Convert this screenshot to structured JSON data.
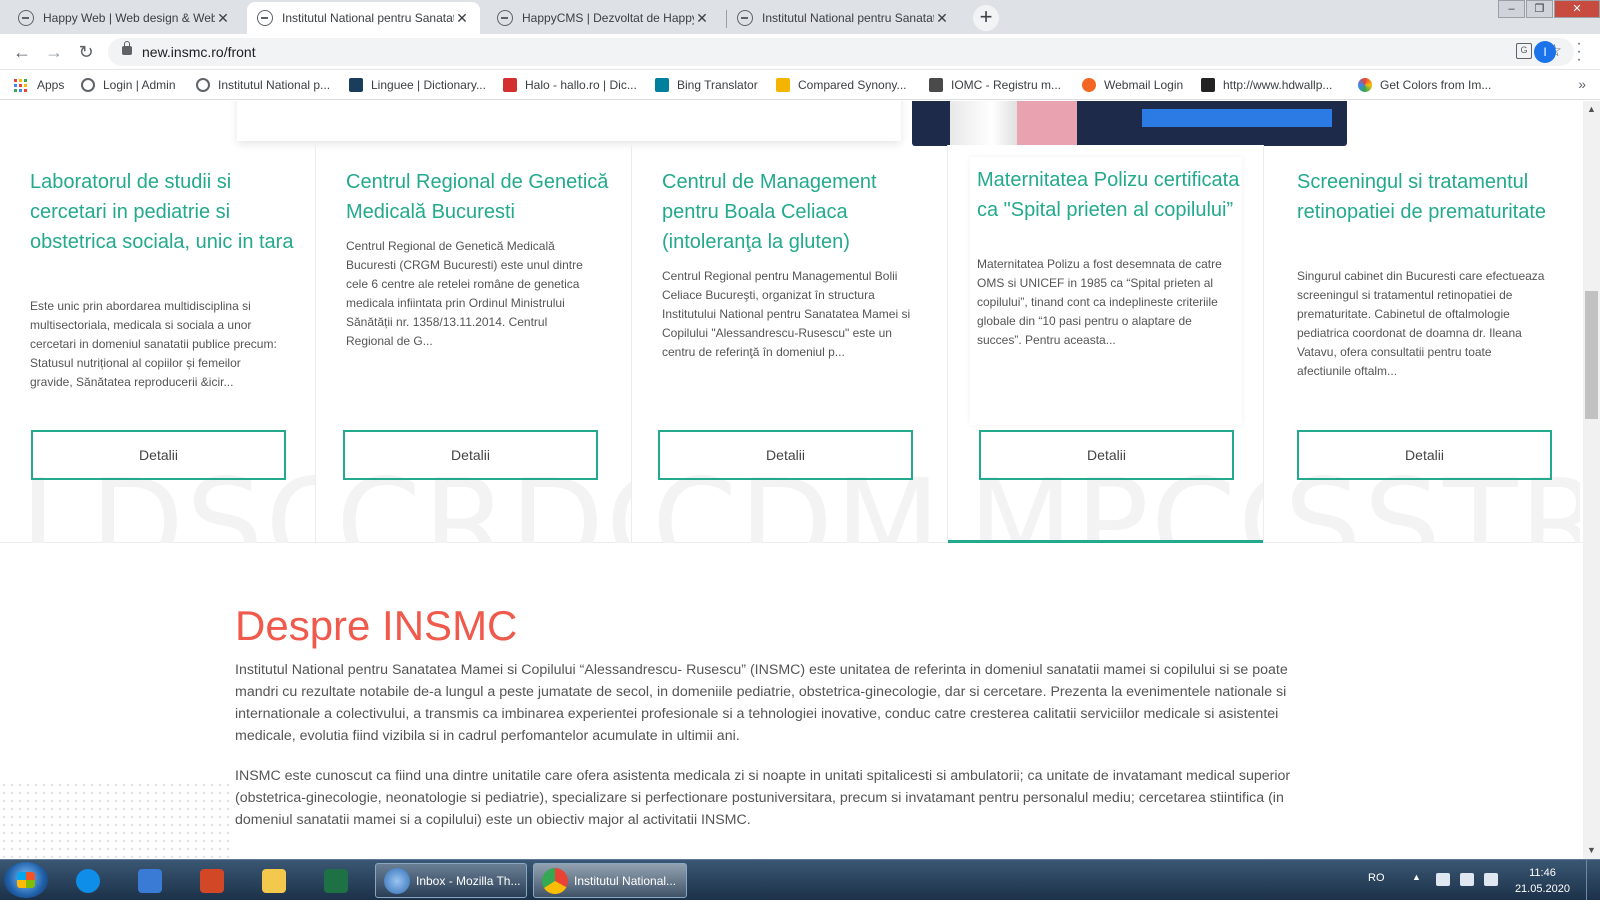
{
  "browser": {
    "tabs": [
      {
        "title": "Happy Web | Web design & Web",
        "active": false
      },
      {
        "title": "Institutul National pentru Sanatat",
        "active": true
      },
      {
        "title": "HappyCMS | Dezvoltat de Happy",
        "active": false
      },
      {
        "title": "Institutul National pentru Sanatat",
        "active": false
      }
    ],
    "tab_close": "✕",
    "new_tab": "+",
    "url": "new.insmc.ro/front",
    "profile_initial": "I",
    "bookmarks": [
      {
        "label": "Apps"
      },
      {
        "label": "Login | Admin"
      },
      {
        "label": "Institutul National p..."
      },
      {
        "label": "Linguee | Dictionary..."
      },
      {
        "label": "Halo - hallo.ro | Dic..."
      },
      {
        "label": "Bing Translator"
      },
      {
        "label": "Compared Synony..."
      },
      {
        "label": "IOMC - Registru m..."
      },
      {
        "label": "Webmail Login"
      },
      {
        "label": "http://www.hdwallp..."
      },
      {
        "label": "Get Colors from Im..."
      }
    ],
    "bookmarks_more": "»"
  },
  "page": {
    "services": [
      {
        "title": "Laboratorul de studii si cercetari in pediatrie si obstetrica sociala, unic in tara",
        "description": "Este unic prin  abordarea multidisciplina si multisectoriala, medicala si sociala a unor cercetari in  domeniul sanatatii publice precum: Statusul nutrițional al copiilor și femeilor gravide, Sănătatea reproducerii &icir...",
        "button": "Detalii",
        "watermark": "LDSC"
      },
      {
        "title": "Centrul Regional de Genetică Medicală Bucuresti",
        "description": "Centrul Regional de Genetică Medicală Bucuresti (CRGM Bucuresti) este unul dintre cele 6 centre ale retelei române de genetica medicala infiintata prin Ordinul Ministrului Sănătății nr. 1358/13.11.2014. Centrul Regional de G...",
        "button": "Detalii",
        "watermark": "CRDG"
      },
      {
        "title": "Centrul de Management pentru Boala Celiaca (intoleranţa la gluten)",
        "description": "Centrul Regional pentru Managementul Bolii Celiace Bucureşti, organizat în structura Institutului National pentru Sanatatea Mamei si Copilului \"Alessandrescu-Rusescu\" este un centru de referinţă în domeniul p...",
        "button": "Detalii",
        "watermark": "CDMP"
      },
      {
        "title": "Maternitatea Polizu certificata ca \"Spital prieten al copilului”",
        "description": "Maternitatea Polizu a fost desemnata de catre OMS si UNICEF in 1985 ca “Spital prieten al copilului”, tinand cont ca indeplineste criteriile globale din “10 pasi pentru o alaptare de succes”. Pentru aceasta...",
        "button": "Detalii",
        "watermark": "MPCC"
      },
      {
        "title": "Screeningul si tratamentul retinopatiei de prematuritate",
        "description": "Singurul cabinet din Bucuresti care efectueaza screeningul si tratamentul retinopatiei de prematuritate. Cabinetul de oftalmologie pediatrica coordonat de doamna dr. Ileana Vatavu, ofera consultatii pentru toate afectiunile oftalm...",
        "button": "Detalii",
        "watermark": "SSTR"
      }
    ],
    "about": {
      "title": "Despre INSMC",
      "paragraphs": [
        "Institutul National pentru Sanatatea Mamei si Copilului “Alessandrescu- Rusescu” (INSMC) este unitatea de referinta in domeniul sanatatii mamei si copilului si se poate mandri cu rezultate notabile de-a lungul a peste jumatate de secol, in domeniile pediatrie, obstetrica-ginecologie, dar si cercetare. Prezenta la evenimentele nationale si internationale a colectivului, a transmis ca imbinarea experientei profesionale si a tehnologiei inovative, conduc catre cresterea calitatii serviciilor medicale si asistentei medicale, evolutia fiind vizibila si in cadrul perfomantelor acumulate in ultimii ani.",
        "INSMC este cunoscut ca fiind una dintre unitatile care ofera asistenta medicala zi si noapte in unitati spitalicesti si ambulatorii; ca unitate de invatamant medical superior (obstetrica-ginecologie, neonatologie si pediatrie), specializare si perfectionare postuniversitara, precum si invatamant pentru personalul mediu; cercetarea stiintifica (in domeniul sanatatii mamei si a copilului) este un obiectiv major al activitatii INSMC."
      ]
    }
  },
  "taskbar": {
    "tasks": [
      {
        "label": "Inbox - Mozilla Th..."
      },
      {
        "label": "Institutul National..."
      }
    ],
    "language": "RO",
    "time": "11:46",
    "date": "21.05.2020"
  },
  "colors": {
    "accent_green": "#23a98d",
    "title_red": "#ef5a4c"
  }
}
